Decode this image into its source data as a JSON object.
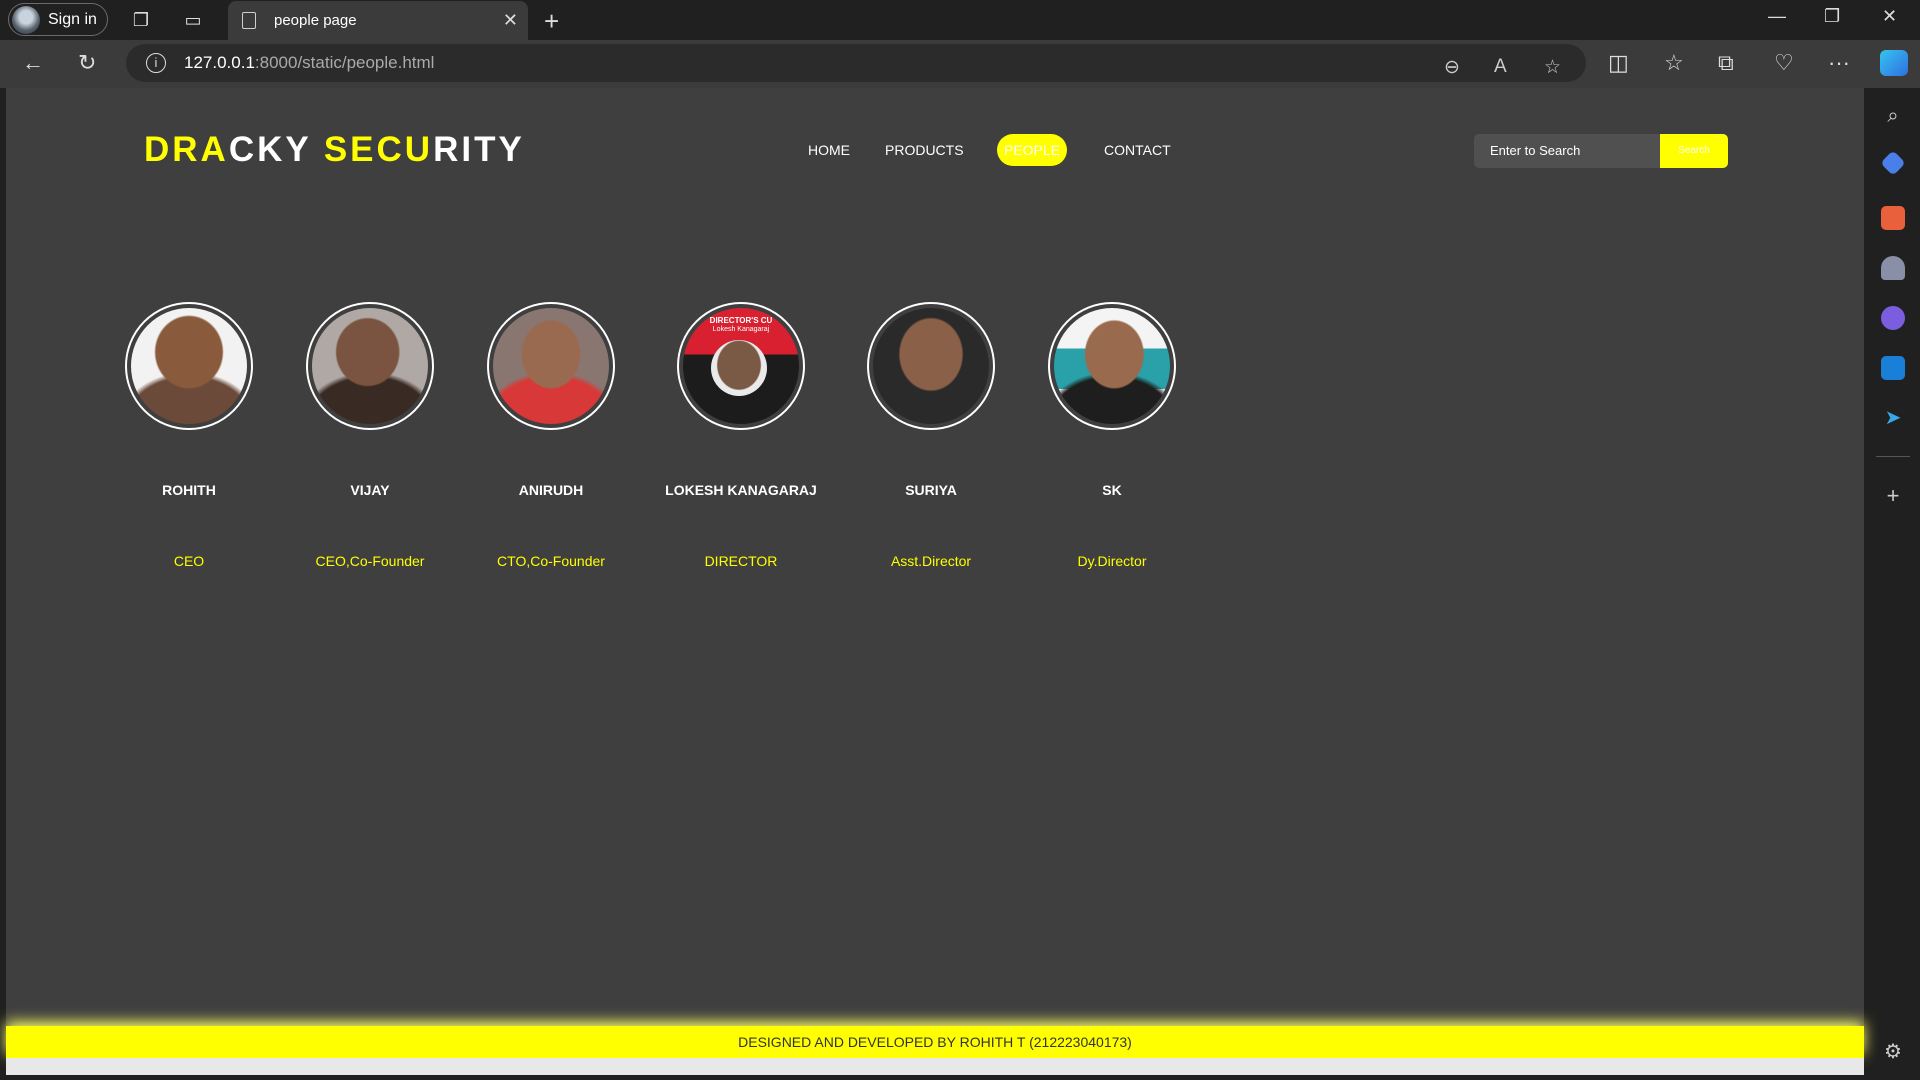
{
  "browser": {
    "signin_label": "Sign in",
    "tab_title": "people page",
    "url_host": "127.0.0.1",
    "url_rest": ":8000/static/people.html"
  },
  "site": {
    "logo_parts": [
      "DRA",
      "CKY ",
      "SECU",
      "RITY"
    ],
    "nav": [
      {
        "label": "HOME"
      },
      {
        "label": "PRODUCTS"
      },
      {
        "label": "PEOPLE",
        "active": true
      },
      {
        "label": "CONTACT"
      }
    ],
    "search": {
      "placeholder": "Enter to Search",
      "button": "Search"
    }
  },
  "people": [
    {
      "name": "ROHITH",
      "role": "CEO"
    },
    {
      "name": "VIJAY",
      "role": "CEO,Co-Founder"
    },
    {
      "name": "ANIRUDH",
      "role": "CTO,Co-Founder"
    },
    {
      "name": "LOKESH KANAGARAJ",
      "role": "DIRECTOR",
      "badge_top": "DIRECTOR'S CU",
      "badge_sub": "Lokesh Kanagaraj"
    },
    {
      "name": "SURIYA",
      "role": "Asst.Director"
    },
    {
      "name": "SK",
      "role": "Dy.Director"
    }
  ],
  "footer": {
    "text": "DESIGNED AND DEVELOPED BY ROHITH T (212223040173)"
  },
  "colors": {
    "accent": "#ffff00",
    "page_bg": "#3f3f3f"
  }
}
